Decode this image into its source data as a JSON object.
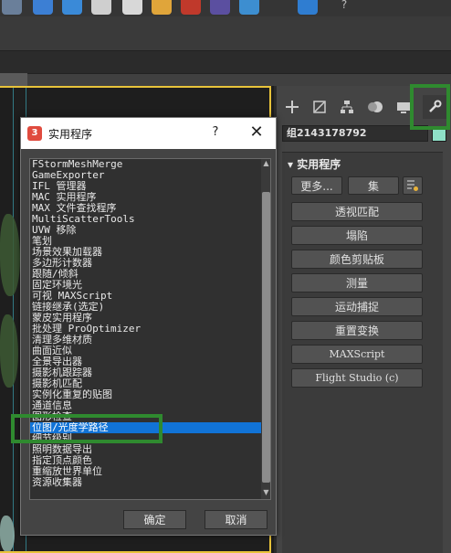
{
  "colors": {
    "selection": "#1173d6",
    "highlight": "#2f8a2f",
    "viewport_frame": "#e8c33a",
    "object_color": "#8fe0c8"
  },
  "toolbar": {
    "icons": [
      "render-icon",
      "render-frame-icon",
      "material-icon",
      "teapot-icon",
      "render-setup-icon",
      "folder-icon",
      "red-app-icon",
      "shield-icon",
      "globe-icon",
      "blue-app-icon",
      "help-icon"
    ]
  },
  "command_panel": {
    "tabs": [
      "create-icon",
      "modify-icon",
      "hierarchy-icon",
      "motion-icon",
      "display-icon",
      "utilities-icon"
    ],
    "object_name": "组2143178792",
    "rollout_title": "实用程序",
    "more_label": "更多...",
    "sets_label": "集",
    "buttons": [
      "透视匹配",
      "塌陷",
      "颜色剪贴板",
      "测量",
      "运动捕捉",
      "重置变换",
      "MAXScript",
      "Flight Studio (c)"
    ]
  },
  "dialog": {
    "title": "实用程序",
    "help_label": "?",
    "items": [
      "FStormMeshMerge",
      "GameExporter",
      "IFL 管理器",
      "MAC 实用程序",
      "MAX 文件查找程序",
      "MultiScatterTools",
      "UVW 移除",
      "笔划",
      "场景效果加载器",
      "多边形计数器",
      "跟随/倾斜",
      "固定环境光",
      "可视 MAXScript",
      "链接继承(选定)",
      "蒙皮实用程序",
      "批处理 ProOptimizer",
      "清理多维材质",
      "曲面近似",
      "全景导出器",
      "摄影机跟踪器",
      "摄影机匹配",
      "实例化重复的贴图",
      "通道信息",
      "图形检查",
      "位图/光度学路径",
      "细节级别",
      "照明数据导出",
      "指定顶点颜色",
      "重缩放世界单位",
      "资源收集器"
    ],
    "selected_index": 24,
    "ok_label": "确定",
    "cancel_label": "取消"
  }
}
